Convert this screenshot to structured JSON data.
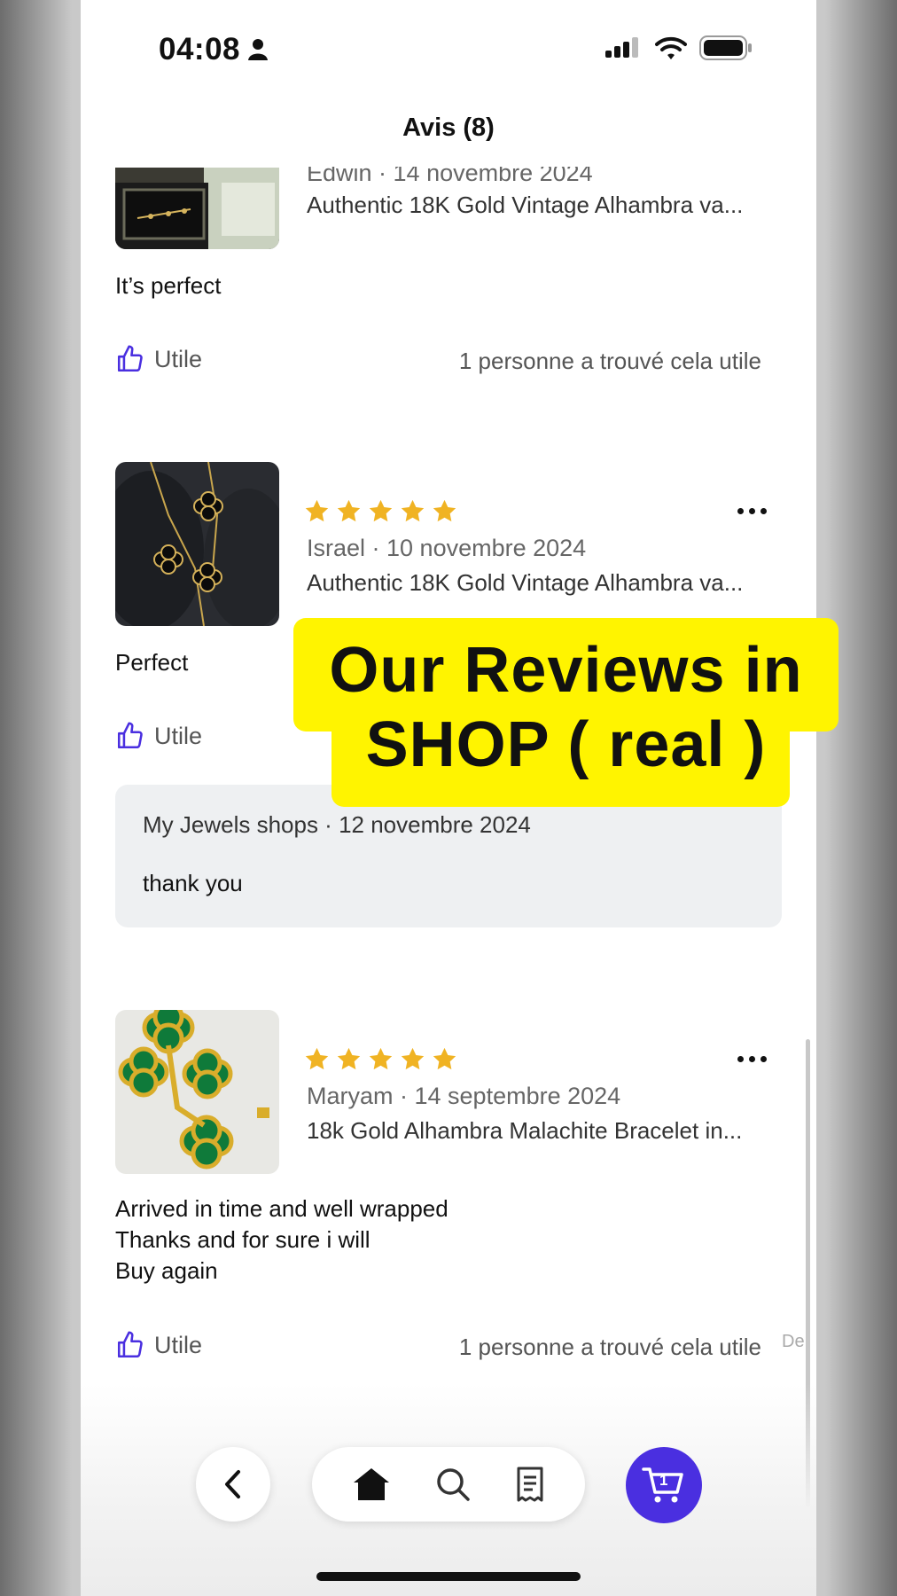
{
  "status_bar": {
    "time": "04:08"
  },
  "header": {
    "title": "Avis (8)"
  },
  "reviews": [
    {
      "author_date": "Edwin · 14 novembre 2024",
      "product": "Authentic 18K Gold Vintage Alhambra va...",
      "body": "It’s perfect",
      "helpful_label": "Utile",
      "helpful_count": "1 personne a trouvé cela utile"
    },
    {
      "rating": 5,
      "author_date": "Israel · 10 novembre 2024",
      "product": "Authentic 18K Gold Vintage Alhambra va...",
      "body": "Perfect",
      "helpful_label": "Utile",
      "reply": {
        "author_date": "My Jewels shops · 12 novembre 2024",
        "text": "thank you"
      }
    },
    {
      "rating": 5,
      "author_date": "Maryam · 14 septembre 2024",
      "product": "18k Gold Alhambra Malachite Bracelet in...",
      "body": "Arrived in time and well wrapped\nThanks and for sure i will\nBuy again",
      "helpful_label": "Utile",
      "helpful_count": "1 personne a trouvé cela utile"
    }
  ],
  "overlay": {
    "line1": "Our Reviews in",
    "line2": "SHOP ( real )"
  },
  "clipped_text": "De",
  "bottom_nav": {
    "cart_count": "1"
  },
  "colors": {
    "accent": "#4a2fe0",
    "star": "#f0b323",
    "highlight": "#fff400"
  }
}
